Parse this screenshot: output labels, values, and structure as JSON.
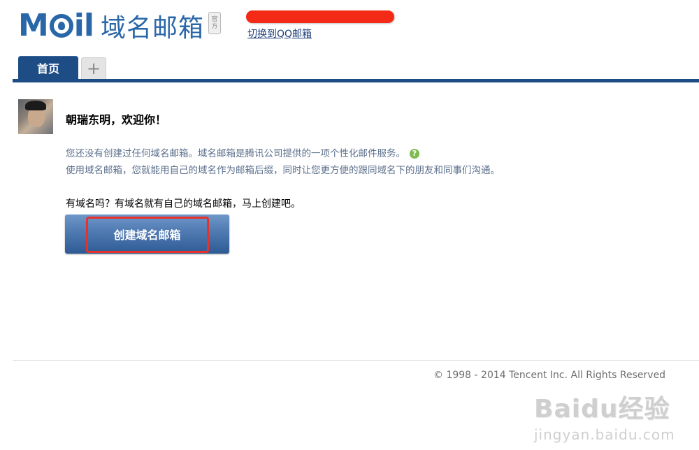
{
  "header": {
    "logo_word_m": "M",
    "logo_word_il": "il",
    "logo_sub": "域名邮箱",
    "logo_seal": "官方",
    "switch_link": "切换到QQ邮箱"
  },
  "tabs": {
    "home_label": "首页",
    "add_label": "+"
  },
  "main": {
    "welcome_text": "朝瑞东明，欢迎你！",
    "desc_line1": "您还没有创建过任何域名邮箱。域名邮箱是腾讯公司提供的一项个性化邮件服务。",
    "help_glyph": "?",
    "desc_line2": "使用域名邮箱，您就能用自己的域名作为邮箱后缀，同时让您更方便的跟同域名下的朋友和同事们沟通。",
    "question": "有域名吗？有域名就有自己的域名邮箱，马上创建吧。",
    "create_button": "创建域名邮箱"
  },
  "footer": {
    "copyright": "© 1998 - 2014 Tencent Inc. All Rights Reserved"
  },
  "watermark": {
    "main": "Baidu经验",
    "url": "jingyan.baidu.com"
  },
  "colors": {
    "brand_blue": "#2a67a8",
    "tab_active": "#1d4d84",
    "redaction": "#f32a16",
    "highlight_box": "#e8312a",
    "help_green": "#7dbb4e"
  },
  "icons": [
    "logo-o-icon",
    "help-icon",
    "plus-icon"
  ]
}
